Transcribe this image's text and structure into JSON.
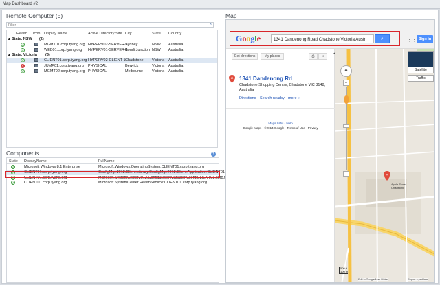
{
  "window": {
    "title": "Map Dashboard #2"
  },
  "left": {
    "remote_title": "Remote Computer (5)",
    "filter_placeholder": "Filter",
    "columns": [
      "Health",
      "Icon",
      "Display Name",
      "Active Directory Site",
      "City",
      "State",
      "Country"
    ],
    "groups": [
      {
        "label": "State: NSW",
        "count": "(2)",
        "rows": [
          {
            "health": "ok",
            "name": "MGMT01.corp.tyang.org",
            "site": "HYPERV02-SERVER-1",
            "city": "Sydney",
            "state": "NSW",
            "country": "Australia"
          },
          {
            "health": "ok",
            "name": "WEB01.corp.tyang.org",
            "site": "HYPERV01-SERVER-1",
            "city": "Bondi Junction",
            "state": "NSW",
            "country": "Australia"
          }
        ]
      },
      {
        "label": "State: Victoria",
        "count": "(3)",
        "rows": [
          {
            "health": "ok",
            "name": "CLIENT01.corp.tyang.org",
            "site": "HYPERV02-CLIENT-1",
            "city": "Chadstone",
            "state": "Victoria",
            "country": "Australia",
            "selected": true
          },
          {
            "health": "err",
            "name": "JUMP01.corp.tyang.org",
            "site": "PHYSICAL",
            "city": "Berwick",
            "state": "Victoria",
            "country": "Australia"
          },
          {
            "health": "ok",
            "name": "MGMT02.corp.tyang.org",
            "site": "PHYSICAL",
            "city": "Melbourne",
            "state": "Victoria",
            "country": "Australia"
          }
        ]
      }
    ],
    "components_title": "Components",
    "comp_columns": [
      "State",
      "DisplayName",
      "FullName"
    ],
    "components": [
      {
        "name": "Microsoft Windows 8.1 Enterprise",
        "full": "Microsoft.Windows.OperatingSystem:CLIENT01.corp.tyang.org"
      },
      {
        "name": "CLIENT01.corp.tyang.org",
        "full": "ConfigMgr.2012.Client.Library.ConfigMgr.2012.Client.Application:CLIENT01.co"
      },
      {
        "name": "CLIENT01.corp.tyang.org",
        "full": "Microsoft.SystemCenter2012.ConfigurationManager.Client:CLIENT01.corp.tyang.org"
      },
      {
        "name": "CLIENT01.corp.tyang.org",
        "full": "Microsoft.SystemCenter.HealthService:CLIENT01.corp.tyang.org"
      }
    ]
  },
  "map": {
    "title": "Map",
    "google_label": "Google",
    "search_value": "1341 Dandenong Road Chadstone Victoria Austr",
    "sign_in": "Sign in",
    "get_directions": "Get directions",
    "my_places": "My places",
    "place_title": "1341 Dandenong Rd",
    "place_addr1": "Chadstone Shopping Centre, Chadstone VIC 3148,",
    "place_addr2": "Australia",
    "link_directions": "Directions",
    "link_nearby": "Search nearby",
    "link_more": "more »",
    "maps_labs": "Maps Labs - Help",
    "footer": "Google Maps - ©2014 Google - Terms of Use - Privacy",
    "satellite": "Satellite",
    "traffic": "Traffic",
    "scale": "500 ft\n100 m",
    "bottom_edit": "Edit in Google Map Maker",
    "bottom_report": "Report a problem",
    "store_label": "Apple Store\nChadstone",
    "streets": [
      "Phoenix Park",
      "Chadstone",
      "Princes Hwy",
      "Dandenong Rd",
      "Warrigal Rd",
      "Chadstone Rd"
    ]
  },
  "colors": {
    "accent": "#4d90fe",
    "highlight": "#d8262b",
    "selected_row": "#dde7f3"
  }
}
